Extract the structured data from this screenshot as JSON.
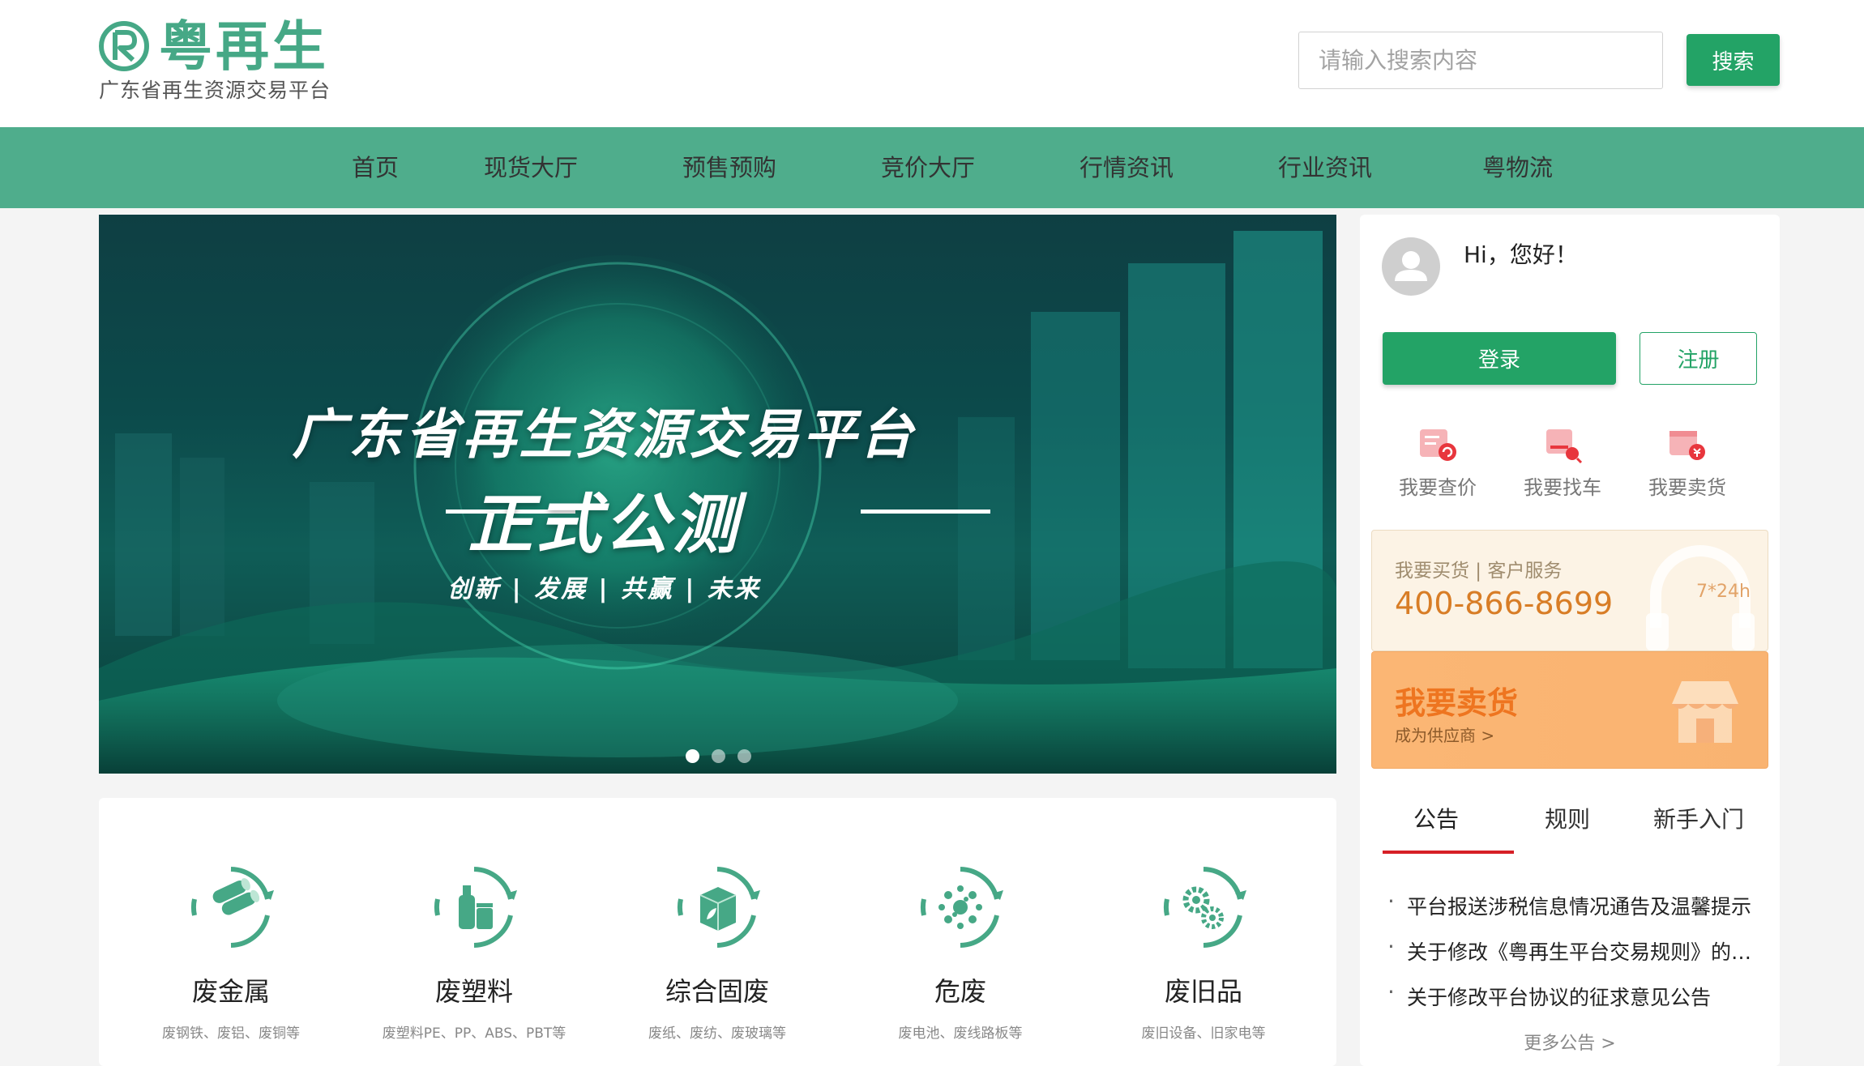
{
  "brand": {
    "logo_mark": "R",
    "title": "粤再生",
    "subtitle": "广东省再生资源交易平台",
    "color": "#46a886"
  },
  "search": {
    "placeholder": "请输入搜索内容",
    "button": "搜索"
  },
  "nav": {
    "items": [
      "首页",
      "现货大厅",
      "预售预购",
      "竞价大厅",
      "行情资讯",
      "行业资讯",
      "粤物流"
    ]
  },
  "banner": {
    "title": "广东省再生资源交易平台",
    "subtitle": "正式公测",
    "tagline": "创新 | 发展 | 共赢 | 未来",
    "slides": 3,
    "active_slide": 1
  },
  "user": {
    "greeting": "Hi，您好！",
    "login": "登录",
    "register": "注册"
  },
  "quick": [
    {
      "label": "我要查价",
      "icon": "price-check-icon"
    },
    {
      "label": "我要找车",
      "icon": "find-truck-icon"
    },
    {
      "label": "我要卖货",
      "icon": "sell-goods-icon"
    }
  ],
  "service": {
    "label": "我要买货 | 客户服务",
    "phone": "400-866-8699",
    "hours": "7*24h"
  },
  "sell": {
    "title": "我要卖货",
    "link": "成为供应商 >"
  },
  "tabs": [
    "公告",
    "规则",
    "新手入门"
  ],
  "notices": [
    "平台报送涉税信息情况通告及温馨提示",
    "关于修改《粤再生平台交易规则》的公告",
    "关于修改平台协议的征求意见公告"
  ],
  "more": "更多公告 >",
  "categories": [
    {
      "name": "废金属",
      "desc": "废钢铁、废铝、废铜等",
      "icon": "scrap-metal-icon"
    },
    {
      "name": "废塑料",
      "desc": "废塑料PE、PP、ABS、PBT等",
      "icon": "scrap-plastic-icon"
    },
    {
      "name": "综合固废",
      "desc": "废纸、废纺、废玻璃等",
      "icon": "solid-waste-icon"
    },
    {
      "name": "危废",
      "desc": "废电池、废线路板等",
      "icon": "hazardous-waste-icon"
    },
    {
      "name": "废旧品",
      "desc": "废旧设备、旧家电等",
      "icon": "used-goods-icon"
    }
  ],
  "colors": {
    "primary": "#23a366",
    "nav_bg": "#4fad8c",
    "accent_red": "#d61f26",
    "orange": "#ee7520"
  }
}
